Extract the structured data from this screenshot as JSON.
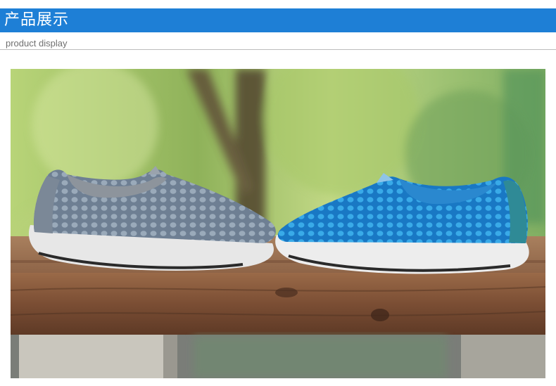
{
  "header": {
    "title": "产品展示",
    "subtitle": "product display"
  },
  "colors": {
    "header_bar": "#1e7fd6",
    "divider": "#bdbdbd",
    "subtitle_text": "#6f6f6f"
  },
  "photo": {
    "subject": "product-photo"
  }
}
